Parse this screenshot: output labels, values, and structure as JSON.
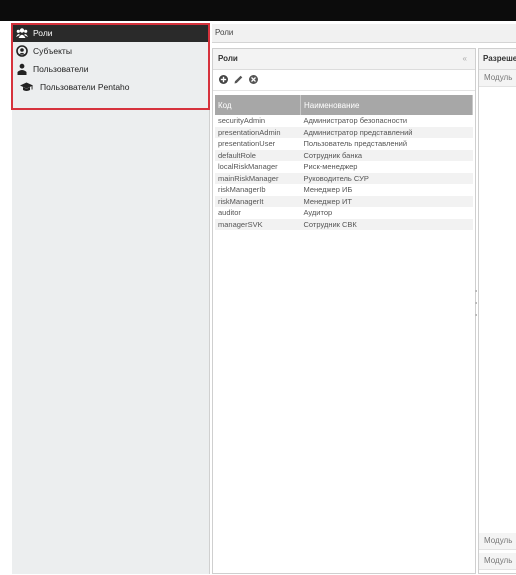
{
  "nav": {
    "items": [
      {
        "label": "Роли",
        "icon": "users-group-icon",
        "active": true
      },
      {
        "label": "Субъекты",
        "icon": "user-circle-icon",
        "active": false
      },
      {
        "label": "Пользователи",
        "icon": "user-icon",
        "active": false
      },
      {
        "label": "Пользователи Pentaho",
        "icon": "graduation-cap-icon",
        "active": false
      }
    ]
  },
  "breadcrumb": "Роли",
  "roles_panel": {
    "title": "Роли",
    "collapse_glyph": "«",
    "toolbar": [
      {
        "icon": "add-icon"
      },
      {
        "icon": "edit-icon"
      },
      {
        "icon": "delete-icon"
      }
    ],
    "columns": [
      "Код",
      "Наименование"
    ],
    "rows": [
      [
        "securityAdmin",
        "Администратор безопасности"
      ],
      [
        "presentationAdmin",
        "Администратор представлений"
      ],
      [
        "presentationUser",
        "Пользователь представлений"
      ],
      [
        "defaultRole",
        "Сотрудник банка"
      ],
      [
        "localRiskManager",
        "Риск-менеджер"
      ],
      [
        "mainRiskManager",
        "Руководитель СУР"
      ],
      [
        "riskManagerIb",
        "Менеджер ИБ"
      ],
      [
        "riskManagerIt",
        "Менеджер ИТ"
      ],
      [
        "auditor",
        "Аудитор"
      ],
      [
        "managerSVK",
        "Сотрудник СВК"
      ]
    ]
  },
  "permissions_panel": {
    "title": "Разреше",
    "top_cell": "Модуль",
    "bottom_cells": [
      "Модуль",
      "Модуль"
    ]
  }
}
